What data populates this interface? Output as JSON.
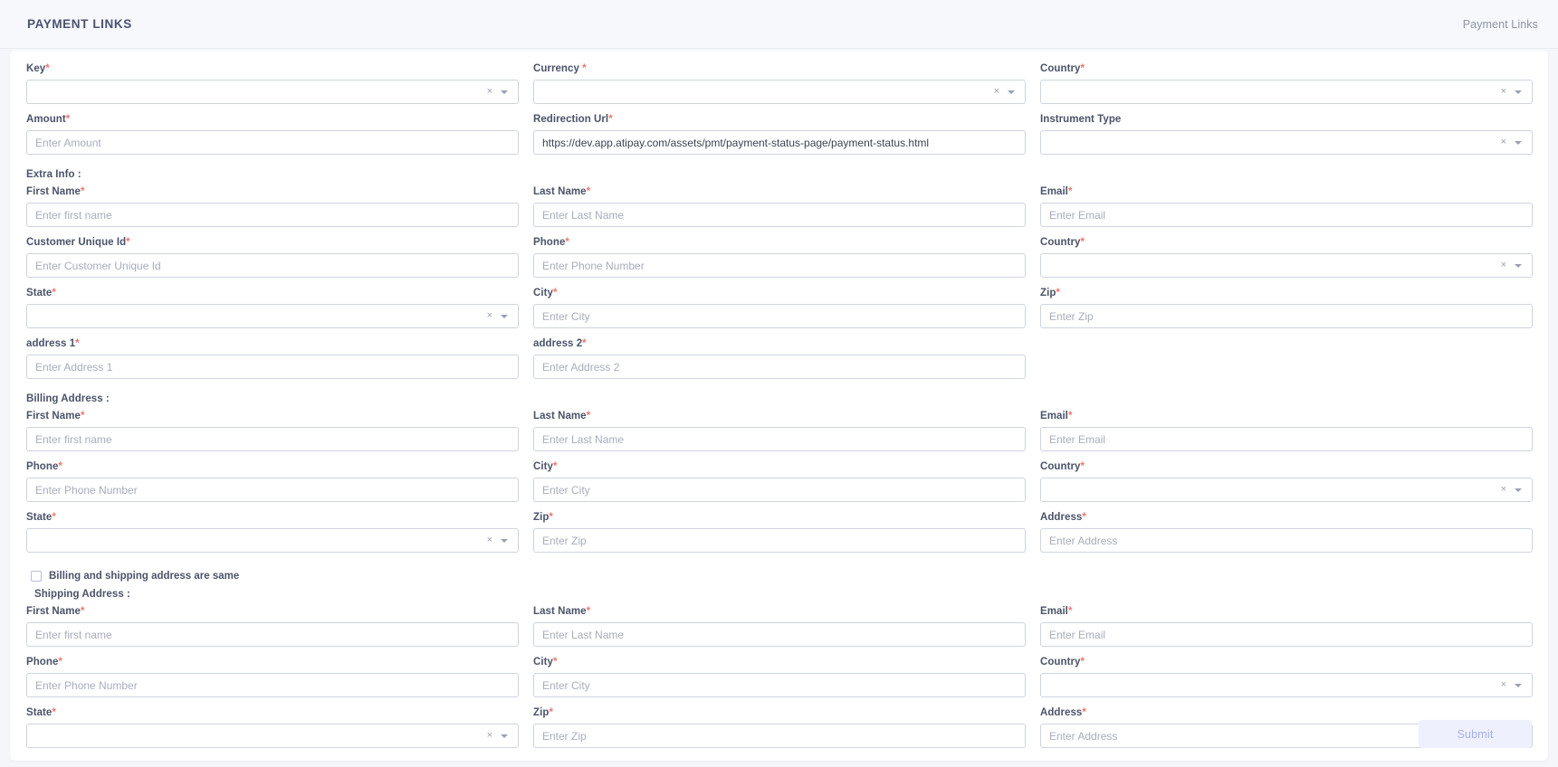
{
  "header": {
    "title": "PAYMENT LINKS",
    "breadcrumb": "Payment Links"
  },
  "form": {
    "row1": {
      "key": {
        "label": "Key",
        "required": "*",
        "value": "",
        "clear_icon": "×"
      },
      "currency": {
        "label": "Currency ",
        "required": "*",
        "value": "",
        "clear_icon": "×"
      },
      "country": {
        "label": "Country",
        "required": "*",
        "value": "",
        "clear_icon": "×"
      }
    },
    "row2": {
      "amount": {
        "label": "Amount",
        "required": "*",
        "placeholder": "Enter Amount",
        "value": ""
      },
      "redirection_url": {
        "label": "Redirection Url",
        "required": "*",
        "value": "https://dev.app.atipay.com/assets/pmt/payment-status-page/payment-status.html"
      },
      "instrument_type": {
        "label": "Instrument Type",
        "required": "",
        "value": "",
        "clear_icon": "×"
      }
    },
    "extra_info": {
      "heading": "Extra Info :",
      "first_name": {
        "label": "First Name",
        "required": "*",
        "placeholder": "Enter first name",
        "value": ""
      },
      "last_name": {
        "label": "Last Name",
        "required": "*",
        "placeholder": "Enter Last Name",
        "value": ""
      },
      "email": {
        "label": "Email",
        "required": "*",
        "placeholder": "Enter Email",
        "value": ""
      },
      "customer_unique_id": {
        "label": "Customer Unique Id",
        "required": "*",
        "placeholder": "Enter Customer Unique Id",
        "value": ""
      },
      "phone": {
        "label": "Phone",
        "required": "*",
        "placeholder": "Enter Phone Number",
        "value": ""
      },
      "country": {
        "label": "Country",
        "required": "*",
        "value": "",
        "clear_icon": "×"
      },
      "state": {
        "label": "State",
        "required": "*",
        "value": "",
        "clear_icon": "×"
      },
      "city": {
        "label": "City",
        "required": "*",
        "placeholder": "Enter City",
        "value": ""
      },
      "zip": {
        "label": "Zip",
        "required": "*",
        "placeholder": "Enter Zip",
        "value": ""
      },
      "address1": {
        "label": "address 1",
        "required": "*",
        "placeholder": "Enter Address 1",
        "value": ""
      },
      "address2": {
        "label": "address 2",
        "required": "*",
        "placeholder": "Enter Address 2",
        "value": ""
      }
    },
    "billing_address": {
      "heading": "Billing Address :",
      "first_name": {
        "label": "First Name",
        "required": "*",
        "placeholder": "Enter first name",
        "value": ""
      },
      "last_name": {
        "label": "Last Name",
        "required": "*",
        "placeholder": "Enter Last Name",
        "value": ""
      },
      "email": {
        "label": "Email",
        "required": "*",
        "placeholder": "Enter Email",
        "value": ""
      },
      "phone": {
        "label": "Phone",
        "required": "*",
        "placeholder": "Enter Phone Number",
        "value": ""
      },
      "city": {
        "label": "City",
        "required": "*",
        "placeholder": "Enter City",
        "value": ""
      },
      "country": {
        "label": "Country",
        "required": "*",
        "value": "",
        "clear_icon": "×"
      },
      "state": {
        "label": "State",
        "required": "*",
        "value": "",
        "clear_icon": "×"
      },
      "zip": {
        "label": "Zip",
        "required": "*",
        "placeholder": "Enter Zip",
        "value": ""
      },
      "address": {
        "label": "Address",
        "required": "*",
        "placeholder": "Enter Address",
        "value": ""
      }
    },
    "same_address": {
      "label": "Billing and shipping address are same",
      "checked": false
    },
    "shipping_address": {
      "heading": "Shipping Address :",
      "first_name": {
        "label": "First Name",
        "required": "*",
        "placeholder": "Enter first name",
        "value": ""
      },
      "last_name": {
        "label": "Last Name",
        "required": "*",
        "placeholder": "Enter Last Name",
        "value": ""
      },
      "email": {
        "label": "Email",
        "required": "*",
        "placeholder": "Enter Email",
        "value": ""
      },
      "phone": {
        "label": "Phone",
        "required": "*",
        "placeholder": "Enter Phone Number",
        "value": ""
      },
      "city": {
        "label": "City",
        "required": "*",
        "placeholder": "Enter City",
        "value": ""
      },
      "country": {
        "label": "Country",
        "required": "*",
        "value": "",
        "clear_icon": "×"
      },
      "state": {
        "label": "State",
        "required": "*",
        "value": "",
        "clear_icon": "×"
      },
      "zip": {
        "label": "Zip",
        "required": "*",
        "placeholder": "Enter Zip",
        "value": ""
      },
      "address": {
        "label": "Address",
        "required": "*",
        "placeholder": "Enter Address",
        "value": ""
      }
    },
    "submit": {
      "label": "Submit",
      "disabled": true
    }
  },
  "colors": {
    "page_bg": "#f5f6fa",
    "card_bg": "#ffffff",
    "label": "#4b5369",
    "required": "#f2756a",
    "border": "#ced4de",
    "placeholder": "#a8adbd",
    "submit_bg": "#eef0fe",
    "submit_text": "#a8b0f2"
  }
}
